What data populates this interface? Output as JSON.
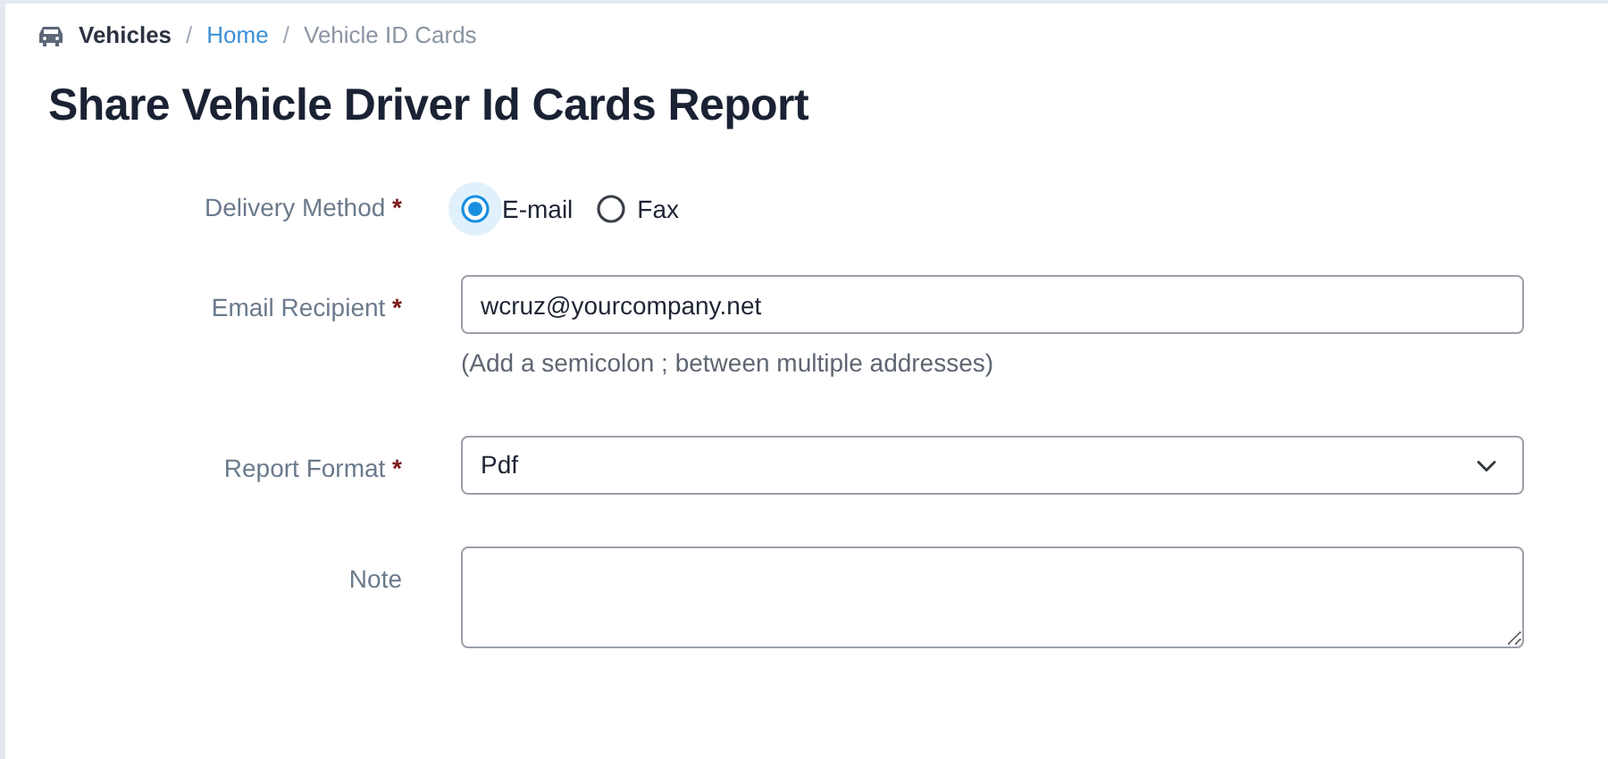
{
  "breadcrumb": [
    {
      "label": "Vehicles",
      "kind": "section"
    },
    {
      "label": "Home",
      "kind": "link"
    },
    {
      "label": "Vehicle ID Cards",
      "kind": "current"
    }
  ],
  "breadcrumb_separators": [
    "/",
    "/"
  ],
  "title": "Share Vehicle Driver Id Cards Report",
  "fields": [
    {
      "kind": "radio",
      "label": "Delivery Method",
      "required_mark": "*",
      "options": [
        {
          "label": "E-mail",
          "selected": true
        },
        {
          "label": "Fax",
          "selected": false
        }
      ]
    },
    {
      "kind": "text",
      "label": "Email Recipient",
      "required_mark": "*",
      "value": "wcruz@yourcompany.net",
      "help": "(Add a semicolon ; between multiple addresses)"
    },
    {
      "kind": "select",
      "label": "Report Format",
      "required_mark": "*",
      "value": "Pdf"
    },
    {
      "kind": "textarea",
      "label": "Note"
    }
  ]
}
